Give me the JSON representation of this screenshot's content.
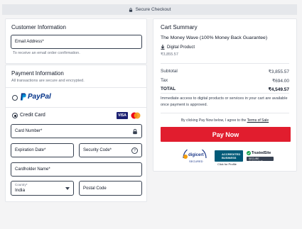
{
  "topbar": {
    "label": "Secure Checkout",
    "icon": "lock-icon"
  },
  "customer": {
    "title": "Customer Information",
    "email_label": "Email Address*",
    "email_hint": "To receive an email order confirmation."
  },
  "payment": {
    "title": "Payment Information",
    "subtitle": "All transactions are secure and encrypted.",
    "paypal_label": "PayPal",
    "credit_label": "Credit Card",
    "card_number_label": "Card Number*",
    "expiration_label": "Expiration Date*",
    "security_label": "Security Code*",
    "cardholder_label": "Cardholder Name*",
    "country_label": "Country*",
    "country_value": "India",
    "postal_label": "Postal Code",
    "selected_method": "credit_card",
    "card_brands": [
      "visa",
      "mastercard"
    ]
  },
  "summary": {
    "title": "Cart Summary",
    "product_title": "The Money Wave (100% Money Back Guarantee)",
    "product_type": "Digital Product",
    "product_price": "₹3,855.57",
    "subtotal_label": "Subtotal",
    "subtotal_value": "₹3,855.57",
    "tax_label": "Tax",
    "tax_value": "₹694.00",
    "total_label": "TOTAL",
    "total_value": "₹4,549.57",
    "access_note": "Immediate access to digital products or services in your cart are available once payment is approved.",
    "terms_prefix": "By clicking Pay Now below, I agree to the",
    "terms_link": "Terms of Sale",
    "pay_button": "Pay Now"
  },
  "trust": {
    "digicert": "digicert",
    "digicert_sub": "SECURED",
    "bbb_line1": "ACCREDITED",
    "bbb_line2": "BUSINESS",
    "bbb_sub": "Click for Profile",
    "trustedsite": "TrustedSite",
    "trustedsite_sub": "SECURE CHECKOUT"
  },
  "colors": {
    "accent": "#e11d2e",
    "paypal_dark": "#003087",
    "paypal_light": "#009cde",
    "bbb": "#005a78"
  }
}
